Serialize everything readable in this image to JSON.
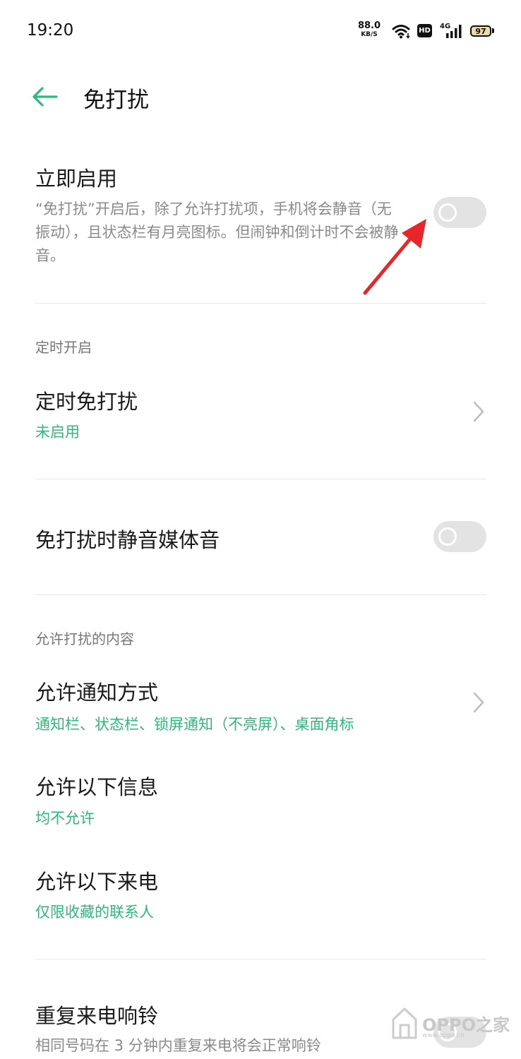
{
  "status": {
    "time": "19:20",
    "net_speed": "88.0",
    "net_unit": "KB/S",
    "hd_label": "HD",
    "network": "4G",
    "battery": "97"
  },
  "header": {
    "title": "免打扰",
    "back_icon": "arrow-left-icon"
  },
  "immediate": {
    "title": "立即启用",
    "description": "“免打扰”开启后，除了允许打扰项，手机将会静音（无振动），且状态栏有月亮图标。但闹钟和倒计时不会被静音。",
    "enabled": false
  },
  "scheduled": {
    "section": "定时开启",
    "title": "定时免打扰",
    "value": "未启用"
  },
  "mute_media": {
    "title": "免打扰时静音媒体音",
    "enabled": false
  },
  "allowed": {
    "section": "允许打扰的内容",
    "items": [
      {
        "title": "允许通知方式",
        "value": "通知栏、状态栏、锁屏通知（不亮屏）、桌面角标"
      },
      {
        "title": "允许以下信息",
        "value": "均不允许"
      },
      {
        "title": "允许以下来电",
        "value": "仅限收藏的联系人"
      }
    ]
  },
  "repeat_call": {
    "title": "重复来电响铃",
    "description": "相同号码在 3 分钟内重复来电将会正常响铃"
  },
  "watermark": {
    "text": "OPPO之家",
    "url": "www.oppo.cn"
  },
  "colors": {
    "accent": "#2fb87a",
    "annotation_arrow": "#e8262a",
    "switch_off": "#e3e3e3"
  }
}
